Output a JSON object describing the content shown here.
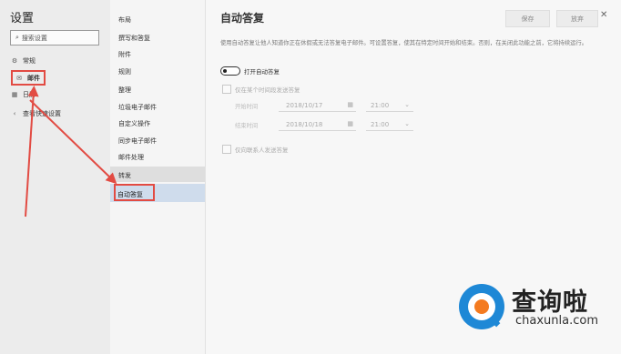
{
  "sidebar": {
    "title": "设置",
    "search_placeholder": "搜索设置",
    "items": [
      {
        "label": "常规",
        "icon": "gear-icon"
      },
      {
        "label": "邮件",
        "icon": "mail-icon"
      },
      {
        "label": "日历",
        "icon": "calendar-icon"
      },
      {
        "label": "查看快速设置",
        "icon": "chevron-left-icon"
      }
    ]
  },
  "mail_menu": {
    "items": [
      "布局",
      "撰写和答复",
      "附件",
      "规则",
      "整理",
      "垃圾电子邮件",
      "自定义操作",
      "同步电子邮件",
      "邮件处理",
      "转发",
      "自动答复"
    ],
    "selected": "自动答复"
  },
  "panel": {
    "title": "自动答复",
    "save_label": "保存",
    "discard_label": "放弃",
    "close_glyph": "✕",
    "description": "使用自动答复让他人知道你正在休假或无法答复电子邮件。可设置答复，使其在特定时间开始和结束。否则，在关闭此功能之前，它将持续运行。",
    "toggle_label": "打开自动答复",
    "toggle_on": false,
    "time_range_label": "仅在某个时间段发送答复",
    "start_label": "开始时间",
    "start_date": "2018/10/17",
    "start_time": "21:00",
    "end_label": "结束时间",
    "end_date": "2018/10/18",
    "end_time": "21:00",
    "contacts_only_label": "仅向联系人发送答复"
  },
  "watermark": {
    "name": "查询啦",
    "domain": "chaxunla.com"
  },
  "colors": {
    "highlight": "#e24b43",
    "selected_bg": "#cfdcec",
    "logo_blue": "#1e88d6",
    "logo_orange": "#f47b20"
  }
}
